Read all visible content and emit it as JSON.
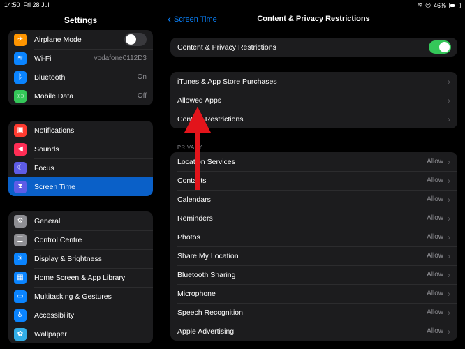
{
  "status": {
    "time": "14:50",
    "date": "Fri 28 Jul",
    "battery": "46%"
  },
  "sidebar": {
    "title": "Settings",
    "group1": [
      {
        "label": "Airplane Mode",
        "icon": "airplane-icon",
        "color": "#ff9500",
        "glyph": "✈",
        "toggle": true
      },
      {
        "label": "Wi-Fi",
        "icon": "wifi-icon",
        "color": "#0a84ff",
        "glyph": "≋",
        "value": "vodafone0112D3"
      },
      {
        "label": "Bluetooth",
        "icon": "bluetooth-icon",
        "color": "#0a84ff",
        "glyph": "ᛒ",
        "value": "On"
      },
      {
        "label": "Mobile Data",
        "icon": "antenna-icon",
        "color": "#34c759",
        "glyph": "((·))",
        "value": "Off"
      }
    ],
    "group2": [
      {
        "label": "Notifications",
        "icon": "bell-icon",
        "color": "#ff3b30",
        "glyph": "▣"
      },
      {
        "label": "Sounds",
        "icon": "speaker-icon",
        "color": "#ff2d55",
        "glyph": "◀"
      },
      {
        "label": "Focus",
        "icon": "moon-icon",
        "color": "#5e5ce6",
        "glyph": "☾"
      },
      {
        "label": "Screen Time",
        "icon": "hourglass-icon",
        "color": "#5e5ce6",
        "glyph": "⧗",
        "active": true
      }
    ],
    "group3": [
      {
        "label": "General",
        "icon": "gear-icon",
        "color": "#8e8e93",
        "glyph": "⚙"
      },
      {
        "label": "Control Centre",
        "icon": "switches-icon",
        "color": "#8e8e93",
        "glyph": "☰"
      },
      {
        "label": "Display & Brightness",
        "icon": "brightness-icon",
        "color": "#0a84ff",
        "glyph": "☀"
      },
      {
        "label": "Home Screen & App Library",
        "icon": "home-grid-icon",
        "color": "#0a84ff",
        "glyph": "▦"
      },
      {
        "label": "Multitasking & Gestures",
        "icon": "multitask-icon",
        "color": "#0a84ff",
        "glyph": "▭"
      },
      {
        "label": "Accessibility",
        "icon": "accessibility-icon",
        "color": "#0a84ff",
        "glyph": "♿"
      },
      {
        "label": "Wallpaper",
        "icon": "flower-icon",
        "color": "#32ade6",
        "glyph": "✿"
      }
    ]
  },
  "detail": {
    "back_label": "Screen Time",
    "title": "Content & Privacy Restrictions",
    "master_toggle_label": "Content & Privacy Restrictions",
    "store_rows": [
      "iTunes & App Store Purchases",
      "Allowed Apps",
      "Content Restrictions"
    ],
    "privacy_header": "PRIVACY",
    "privacy_rows": [
      {
        "label": "Location Services",
        "value": "Allow"
      },
      {
        "label": "Contacts",
        "value": "Allow"
      },
      {
        "label": "Calendars",
        "value": "Allow"
      },
      {
        "label": "Reminders",
        "value": "Allow"
      },
      {
        "label": "Photos",
        "value": "Allow"
      },
      {
        "label": "Share My Location",
        "value": "Allow"
      },
      {
        "label": "Bluetooth Sharing",
        "value": "Allow"
      },
      {
        "label": "Microphone",
        "value": "Allow"
      },
      {
        "label": "Speech Recognition",
        "value": "Allow"
      },
      {
        "label": "Apple Advertising",
        "value": "Allow"
      }
    ]
  },
  "colors": {
    "accent": "#0a84ff",
    "active_row": "#0a60c8",
    "toggle_on": "#34c759",
    "arrow": "#e3141b"
  }
}
